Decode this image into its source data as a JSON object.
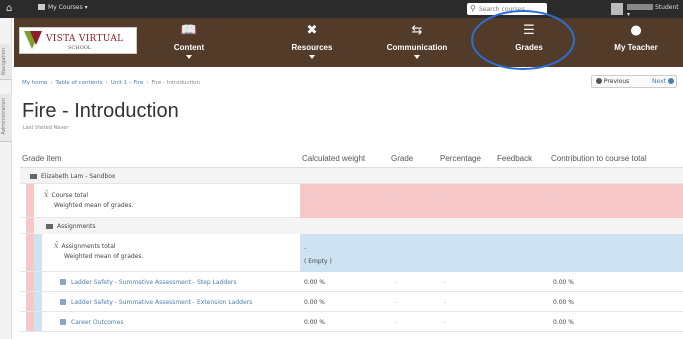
{
  "topbar": {
    "my_courses": "My Courses",
    "search_placeholder": "Search courses...",
    "user_label": "Student"
  },
  "sidebar_tabs": [
    "Navigation",
    "Administration"
  ],
  "logo": {
    "line1": "VISTA VIRTUAL",
    "line2": "SCHOOL"
  },
  "nav": {
    "content": "Content",
    "resources": "Resources",
    "communication": "Communication",
    "grades": "Grades",
    "teacher": "My Teacher"
  },
  "breadcrumb": [
    "My home",
    "Table of contents",
    "Unit 1 – Fire",
    "Fire - Introduction"
  ],
  "buttons": {
    "previous": "Previous",
    "next": "Next"
  },
  "page": {
    "title": "Fire - Introduction",
    "subtitle": "Last Visited Never"
  },
  "columns": {
    "item": "Grade item",
    "weight": "Calculated weight",
    "grade": "Grade",
    "percentage": "Percentage",
    "feedback": "Feedback",
    "contribution": "Contribution to course total"
  },
  "rows": {
    "category": "Elizabeth Lam - Sandbox",
    "course_total": {
      "name": "Course total",
      "desc": "Weighted mean of grades.",
      "weight": "-",
      "grade": "-",
      "percentage": "-",
      "contribution": "-"
    },
    "assignments": "Assignments",
    "assignments_total": {
      "name": "Assignments total",
      "desc": "Weighted mean of grades.",
      "weight": "-",
      "weight_note": "( Empty )",
      "grade": "-",
      "percentage": "-",
      "contribution": "-"
    },
    "items": [
      {
        "name": "Ladder Safety - Summative Assessment - Step Ladders",
        "weight": "0.00 %",
        "grade": "-",
        "percentage": "-",
        "contribution": "0.00 %"
      },
      {
        "name": "Ladder Safety - Summative Assessment - Extension Ladders",
        "weight": "0.00 %",
        "grade": "-",
        "percentage": "-",
        "contribution": "0.00 %"
      },
      {
        "name": "Career Outcomes",
        "weight": "0.00 %",
        "grade": "-",
        "percentage": "-",
        "contribution": "0.00 %"
      }
    ]
  },
  "colors": {
    "nav_bg": "#523b29",
    "course_total_bg": "#f6c8c9",
    "assignments_bg": "#cfe2f2",
    "link": "#4a7fb0",
    "highlight": "#2a6fd6"
  }
}
